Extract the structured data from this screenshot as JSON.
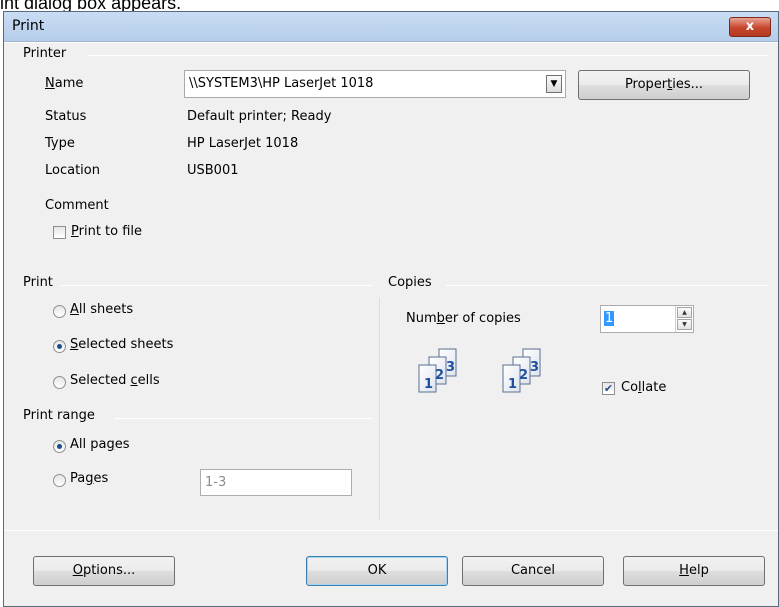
{
  "caption": "int dialog box appears.",
  "dialog": {
    "title": "Print",
    "close_label": "x"
  },
  "printer": {
    "section_title": "Printer",
    "name_label": "Name",
    "name_value": "\\\\SYSTEM3\\HP LaserJet 1018",
    "properties_label": "Properties...",
    "status_label": "Status",
    "status_value": "Default printer; Ready",
    "type_label": "Type",
    "type_value": "HP LaserJet 1018",
    "location_label": "Location",
    "location_value": "USB001",
    "comment_label": "Comment",
    "print_to_file_label": "Print to file",
    "print_to_file_checked": false
  },
  "print": {
    "section_title": "Print",
    "options": [
      {
        "label": "All sheets",
        "selected": false
      },
      {
        "label": "Selected sheets",
        "selected": true
      },
      {
        "label": "Selected cells",
        "selected": false
      }
    ]
  },
  "print_range": {
    "section_title": "Print range",
    "all_pages_label": "All pages",
    "all_pages_selected": true,
    "pages_label": "Pages",
    "pages_selected": false,
    "pages_value": "1-3"
  },
  "copies": {
    "section_title": "Copies",
    "number_label": "Number of copies",
    "number_value": "1",
    "collate_label": "Collate",
    "collate_checked": true,
    "page_numbers": [
      "1",
      "2",
      "3"
    ]
  },
  "buttons": {
    "options": "Options...",
    "ok": "OK",
    "cancel": "Cancel",
    "help": "Help"
  }
}
